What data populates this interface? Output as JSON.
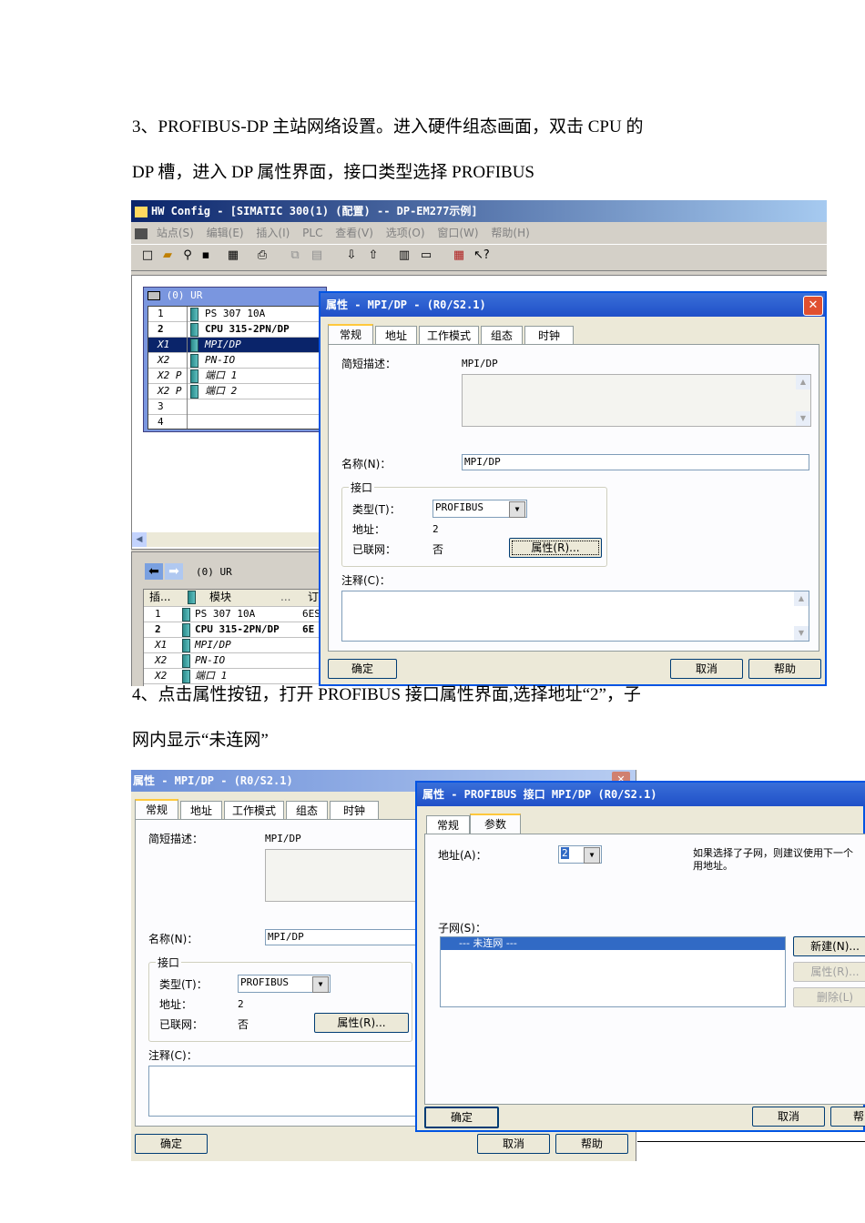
{
  "doc": {
    "para1_line1": "3、PROFIBUS-DP 主站网络设置。进入硬件组态画面，双击 CPU 的",
    "para1_line2": "DP 槽，进入 DP 属性界面，接口类型选择 PROFIBUS",
    "para2_line1": "4、点击属性按钮，打开 PROFIBUS 接口属性界面,选择地址“2”，子",
    "para2_line2": "网内显示“未连网”"
  },
  "shot1": {
    "app_title": "HW Config - [SIMATIC 300(1) (配置) -- DP-EM277示例]",
    "menu": [
      "站点(S)",
      "编辑(E)",
      "插入(I)",
      "PLC",
      "查看(V)",
      "选项(O)",
      "窗口(W)",
      "帮助(H)"
    ],
    "rack_title": "(0)  UR",
    "rack_rows": [
      {
        "slot": "1",
        "module": "PS 307 10A"
      },
      {
        "slot": "2",
        "module": "CPU 315-2PN/DP"
      },
      {
        "slot": "X1",
        "module": "MPI/DP"
      },
      {
        "slot": "X2",
        "module": "PN-IO"
      },
      {
        "slot": "X2 P",
        "module": "端口 1"
      },
      {
        "slot": "X2 P",
        "module": "端口 2"
      },
      {
        "slot": "3",
        "module": ""
      },
      {
        "slot": "4",
        "module": ""
      }
    ],
    "lower_title": "(0)    UR",
    "lower_headers": [
      "插...",
      "模块",
      "...",
      "订"
    ],
    "lower_rows": [
      {
        "slot": "1",
        "module": "PS 307 10A",
        "order": "6ES"
      },
      {
        "slot": "2",
        "module": "CPU 315-2PN/DP",
        "order": "6E"
      },
      {
        "slot": "X1",
        "module": "MPI/DP",
        "order": ""
      },
      {
        "slot": "X2",
        "module": "PN-IO",
        "order": ""
      },
      {
        "slot": "X2",
        "module": "端口 1",
        "order": ""
      }
    ],
    "dialog_title": "属性 - MPI/DP - (R0/S2.1)",
    "tabs": [
      "常规",
      "地址",
      "工作模式",
      "组态",
      "时钟"
    ],
    "short_desc_label": "简短描述：",
    "short_desc_value": "MPI/DP",
    "name_label": "名称(N)：",
    "name_value": "MPI/DP",
    "interface_group": "接口",
    "type_label": "类型(T)：",
    "type_value": "PROFIBUS",
    "address_label": "地址：",
    "address_value": "2",
    "networked_label": "已联网：",
    "networked_value": "否",
    "properties_button": "属性(R)...",
    "comment_label": "注释(C)：",
    "ok_button": "确定",
    "cancel_button": "取消",
    "help_button": "帮助"
  },
  "shot2": {
    "back_title": "属性 - MPI/DP - (R0/S2.1)",
    "back_tabs": [
      "常规",
      "地址",
      "工作模式",
      "组态",
      "时钟"
    ],
    "short_desc_label": "简短描述：",
    "short_desc_value": "MPI/DP",
    "name_label": "名称(N)：",
    "name_value": "MPI/DP",
    "interface_group": "接口",
    "type_label": "类型(T)：",
    "type_value": "PROFIBUS",
    "address_label": "地址：",
    "address_value": "2",
    "networked_label": "已联网：",
    "networked_value": "否",
    "properties_button": "属性(R)...",
    "comment_label": "注释(C)：",
    "ok_button": "确定",
    "cancel_button": "取消",
    "help_button": "帮助",
    "front_title": "属性 - PROFIBUS 接口  MPI/DP (R0/S2.1)",
    "front_tabs": [
      "常规",
      "参数"
    ],
    "front_address_label": "地址(A)：",
    "front_address_value": "2",
    "hint_line1": "如果选择了子网，则建议使用下一个",
    "hint_line2": "用地址。",
    "subnet_label": "子网(S)：",
    "subnet_item": "--- 未连网 ---",
    "new_button": "新建(N)...",
    "props_button": "属性(R)...",
    "delete_button": "删除(L)",
    "front_ok": "确定",
    "front_cancel": "取消",
    "front_help": "帮"
  }
}
